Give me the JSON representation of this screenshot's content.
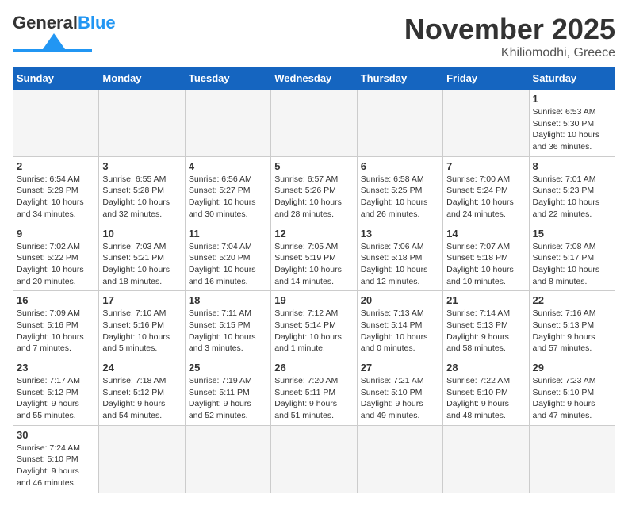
{
  "header": {
    "logo_text_general": "General",
    "logo_text_blue": "Blue",
    "title": "November 2025",
    "location": "Khiliomodhi, Greece"
  },
  "weekdays": [
    "Sunday",
    "Monday",
    "Tuesday",
    "Wednesday",
    "Thursday",
    "Friday",
    "Saturday"
  ],
  "weeks": [
    [
      {
        "day": "",
        "info": ""
      },
      {
        "day": "",
        "info": ""
      },
      {
        "day": "",
        "info": ""
      },
      {
        "day": "",
        "info": ""
      },
      {
        "day": "",
        "info": ""
      },
      {
        "day": "",
        "info": ""
      },
      {
        "day": "1",
        "info": "Sunrise: 6:53 AM\nSunset: 5:30 PM\nDaylight: 10 hours\nand 36 minutes."
      }
    ],
    [
      {
        "day": "2",
        "info": "Sunrise: 6:54 AM\nSunset: 5:29 PM\nDaylight: 10 hours\nand 34 minutes."
      },
      {
        "day": "3",
        "info": "Sunrise: 6:55 AM\nSunset: 5:28 PM\nDaylight: 10 hours\nand 32 minutes."
      },
      {
        "day": "4",
        "info": "Sunrise: 6:56 AM\nSunset: 5:27 PM\nDaylight: 10 hours\nand 30 minutes."
      },
      {
        "day": "5",
        "info": "Sunrise: 6:57 AM\nSunset: 5:26 PM\nDaylight: 10 hours\nand 28 minutes."
      },
      {
        "day": "6",
        "info": "Sunrise: 6:58 AM\nSunset: 5:25 PM\nDaylight: 10 hours\nand 26 minutes."
      },
      {
        "day": "7",
        "info": "Sunrise: 7:00 AM\nSunset: 5:24 PM\nDaylight: 10 hours\nand 24 minutes."
      },
      {
        "day": "8",
        "info": "Sunrise: 7:01 AM\nSunset: 5:23 PM\nDaylight: 10 hours\nand 22 minutes."
      }
    ],
    [
      {
        "day": "9",
        "info": "Sunrise: 7:02 AM\nSunset: 5:22 PM\nDaylight: 10 hours\nand 20 minutes."
      },
      {
        "day": "10",
        "info": "Sunrise: 7:03 AM\nSunset: 5:21 PM\nDaylight: 10 hours\nand 18 minutes."
      },
      {
        "day": "11",
        "info": "Sunrise: 7:04 AM\nSunset: 5:20 PM\nDaylight: 10 hours\nand 16 minutes."
      },
      {
        "day": "12",
        "info": "Sunrise: 7:05 AM\nSunset: 5:19 PM\nDaylight: 10 hours\nand 14 minutes."
      },
      {
        "day": "13",
        "info": "Sunrise: 7:06 AM\nSunset: 5:18 PM\nDaylight: 10 hours\nand 12 minutes."
      },
      {
        "day": "14",
        "info": "Sunrise: 7:07 AM\nSunset: 5:18 PM\nDaylight: 10 hours\nand 10 minutes."
      },
      {
        "day": "15",
        "info": "Sunrise: 7:08 AM\nSunset: 5:17 PM\nDaylight: 10 hours\nand 8 minutes."
      }
    ],
    [
      {
        "day": "16",
        "info": "Sunrise: 7:09 AM\nSunset: 5:16 PM\nDaylight: 10 hours\nand 7 minutes."
      },
      {
        "day": "17",
        "info": "Sunrise: 7:10 AM\nSunset: 5:16 PM\nDaylight: 10 hours\nand 5 minutes."
      },
      {
        "day": "18",
        "info": "Sunrise: 7:11 AM\nSunset: 5:15 PM\nDaylight: 10 hours\nand 3 minutes."
      },
      {
        "day": "19",
        "info": "Sunrise: 7:12 AM\nSunset: 5:14 PM\nDaylight: 10 hours\nand 1 minute."
      },
      {
        "day": "20",
        "info": "Sunrise: 7:13 AM\nSunset: 5:14 PM\nDaylight: 10 hours\nand 0 minutes."
      },
      {
        "day": "21",
        "info": "Sunrise: 7:14 AM\nSunset: 5:13 PM\nDaylight: 9 hours\nand 58 minutes."
      },
      {
        "day": "22",
        "info": "Sunrise: 7:16 AM\nSunset: 5:13 PM\nDaylight: 9 hours\nand 57 minutes."
      }
    ],
    [
      {
        "day": "23",
        "info": "Sunrise: 7:17 AM\nSunset: 5:12 PM\nDaylight: 9 hours\nand 55 minutes."
      },
      {
        "day": "24",
        "info": "Sunrise: 7:18 AM\nSunset: 5:12 PM\nDaylight: 9 hours\nand 54 minutes."
      },
      {
        "day": "25",
        "info": "Sunrise: 7:19 AM\nSunset: 5:11 PM\nDaylight: 9 hours\nand 52 minutes."
      },
      {
        "day": "26",
        "info": "Sunrise: 7:20 AM\nSunset: 5:11 PM\nDaylight: 9 hours\nand 51 minutes."
      },
      {
        "day": "27",
        "info": "Sunrise: 7:21 AM\nSunset: 5:10 PM\nDaylight: 9 hours\nand 49 minutes."
      },
      {
        "day": "28",
        "info": "Sunrise: 7:22 AM\nSunset: 5:10 PM\nDaylight: 9 hours\nand 48 minutes."
      },
      {
        "day": "29",
        "info": "Sunrise: 7:23 AM\nSunset: 5:10 PM\nDaylight: 9 hours\nand 47 minutes."
      }
    ],
    [
      {
        "day": "30",
        "info": "Sunrise: 7:24 AM\nSunset: 5:10 PM\nDaylight: 9 hours\nand 46 minutes."
      },
      {
        "day": "",
        "info": ""
      },
      {
        "day": "",
        "info": ""
      },
      {
        "day": "",
        "info": ""
      },
      {
        "day": "",
        "info": ""
      },
      {
        "day": "",
        "info": ""
      },
      {
        "day": "",
        "info": ""
      }
    ]
  ]
}
